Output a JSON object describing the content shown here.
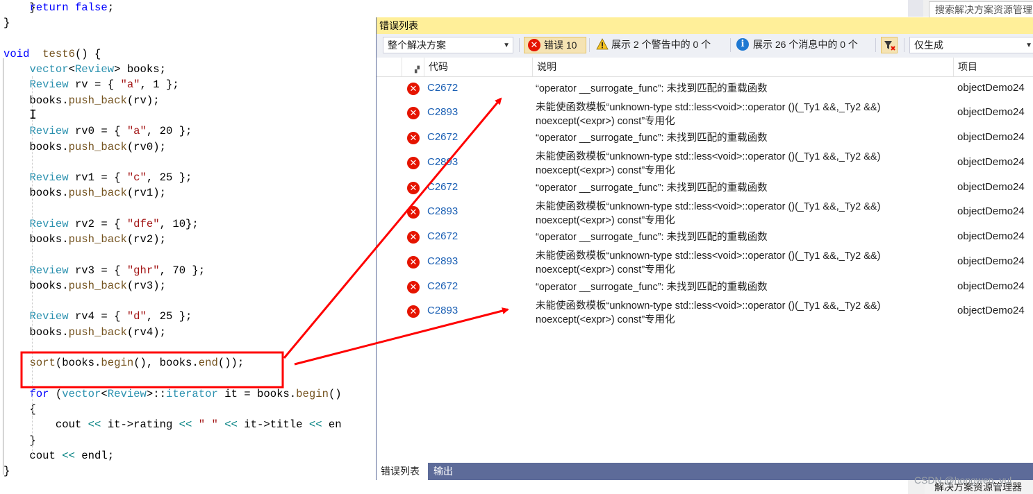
{
  "editor": {
    "lines": [
      [
        {
          "t": "    }",
          "c": ""
        }
      ],
      [
        {
          "t": "    ",
          "c": ""
        },
        {
          "t": "return",
          "c": "kw"
        },
        {
          "t": " ",
          "c": ""
        },
        {
          "t": "false",
          "c": "kw"
        },
        {
          "t": ";",
          "c": ""
        }
      ],
      [
        {
          "t": "}",
          "c": ""
        }
      ],
      [
        {
          "t": "",
          "c": ""
        }
      ],
      [
        {
          "t": "void",
          "c": "kw"
        },
        {
          "t": "  ",
          "c": ""
        },
        {
          "t": "test6",
          "c": "fn"
        },
        {
          "t": "() {",
          "c": ""
        }
      ],
      [
        {
          "t": "    ",
          "c": ""
        },
        {
          "t": "vector",
          "c": "ty"
        },
        {
          "t": "<",
          "c": ""
        },
        {
          "t": "Review",
          "c": "ty"
        },
        {
          "t": "> books;",
          "c": ""
        }
      ],
      [
        {
          "t": "    ",
          "c": ""
        },
        {
          "t": "Review",
          "c": "ty"
        },
        {
          "t": " rv = { ",
          "c": ""
        },
        {
          "t": "\"a\"",
          "c": "str"
        },
        {
          "t": ", 1 };",
          "c": ""
        }
      ],
      [
        {
          "t": "    books.",
          "c": ""
        },
        {
          "t": "push_back",
          "c": "fn"
        },
        {
          "t": "(rv);",
          "c": ""
        }
      ],
      [
        {
          "t": "",
          "c": ""
        }
      ],
      [
        {
          "t": "    ",
          "c": ""
        },
        {
          "t": "Review",
          "c": "ty"
        },
        {
          "t": " rv0 = { ",
          "c": ""
        },
        {
          "t": "\"a\"",
          "c": "str"
        },
        {
          "t": ", 20 };",
          "c": ""
        }
      ],
      [
        {
          "t": "    books.",
          "c": ""
        },
        {
          "t": "push_back",
          "c": "fn"
        },
        {
          "t": "(rv0);",
          "c": ""
        }
      ],
      [
        {
          "t": "",
          "c": ""
        }
      ],
      [
        {
          "t": "    ",
          "c": ""
        },
        {
          "t": "Review",
          "c": "ty"
        },
        {
          "t": " rv1 = { ",
          "c": ""
        },
        {
          "t": "\"c\"",
          "c": "str"
        },
        {
          "t": ", 25 };",
          "c": ""
        }
      ],
      [
        {
          "t": "    books.",
          "c": ""
        },
        {
          "t": "push_back",
          "c": "fn"
        },
        {
          "t": "(rv1);",
          "c": ""
        }
      ],
      [
        {
          "t": "",
          "c": ""
        }
      ],
      [
        {
          "t": "    ",
          "c": ""
        },
        {
          "t": "Review",
          "c": "ty"
        },
        {
          "t": " rv2 = { ",
          "c": ""
        },
        {
          "t": "\"dfe\"",
          "c": "str"
        },
        {
          "t": ", 10};",
          "c": ""
        }
      ],
      [
        {
          "t": "    books.",
          "c": ""
        },
        {
          "t": "push_back",
          "c": "fn"
        },
        {
          "t": "(rv2);",
          "c": ""
        }
      ],
      [
        {
          "t": "",
          "c": ""
        }
      ],
      [
        {
          "t": "    ",
          "c": ""
        },
        {
          "t": "Review",
          "c": "ty"
        },
        {
          "t": " rv3 = { ",
          "c": ""
        },
        {
          "t": "\"ghr\"",
          "c": "str"
        },
        {
          "t": ", 70 };",
          "c": ""
        }
      ],
      [
        {
          "t": "    books.",
          "c": ""
        },
        {
          "t": "push_back",
          "c": "fn"
        },
        {
          "t": "(rv3);",
          "c": ""
        }
      ],
      [
        {
          "t": "",
          "c": ""
        }
      ],
      [
        {
          "t": "    ",
          "c": ""
        },
        {
          "t": "Review",
          "c": "ty"
        },
        {
          "t": " rv4 = { ",
          "c": ""
        },
        {
          "t": "\"d\"",
          "c": "str"
        },
        {
          "t": ", 25 };",
          "c": ""
        }
      ],
      [
        {
          "t": "    books.",
          "c": ""
        },
        {
          "t": "push_back",
          "c": "fn"
        },
        {
          "t": "(rv4);",
          "c": ""
        }
      ],
      [
        {
          "t": "",
          "c": ""
        }
      ],
      [
        {
          "t": "    ",
          "c": ""
        },
        {
          "t": "sort",
          "c": "fn"
        },
        {
          "t": "(books.",
          "c": ""
        },
        {
          "t": "begin",
          "c": "fn"
        },
        {
          "t": "(), books.",
          "c": ""
        },
        {
          "t": "end",
          "c": "fn"
        },
        {
          "t": "());",
          "c": ""
        }
      ],
      [
        {
          "t": "",
          "c": ""
        }
      ],
      [
        {
          "t": "    ",
          "c": ""
        },
        {
          "t": "for",
          "c": "kw"
        },
        {
          "t": " (",
          "c": ""
        },
        {
          "t": "vector",
          "c": "ty"
        },
        {
          "t": "<",
          "c": ""
        },
        {
          "t": "Review",
          "c": "ty"
        },
        {
          "t": ">::",
          "c": ""
        },
        {
          "t": "iterator",
          "c": "ty"
        },
        {
          "t": " it = books.",
          "c": ""
        },
        {
          "t": "begin",
          "c": "fn"
        },
        {
          "t": "()",
          "c": ""
        }
      ],
      [
        {
          "t": "    {",
          "c": ""
        }
      ],
      [
        {
          "t": "        cout ",
          "c": ""
        },
        {
          "t": "<<",
          "c": "op"
        },
        {
          "t": " it->rating ",
          "c": ""
        },
        {
          "t": "<<",
          "c": "op"
        },
        {
          "t": " ",
          "c": ""
        },
        {
          "t": "\" \"",
          "c": "str"
        },
        {
          "t": " ",
          "c": ""
        },
        {
          "t": "<<",
          "c": "op"
        },
        {
          "t": " it->title ",
          "c": ""
        },
        {
          "t": "<<",
          "c": "op"
        },
        {
          "t": " en",
          "c": ""
        }
      ],
      [
        {
          "t": "    }",
          "c": ""
        }
      ],
      [
        {
          "t": "    cout ",
          "c": ""
        },
        {
          "t": "<<",
          "c": "op"
        },
        {
          "t": " endl;",
          "c": ""
        }
      ],
      [
        {
          "t": "}",
          "c": ""
        }
      ]
    ]
  },
  "solution_explorer": {
    "search_placeholder": "搜索解决方案资源管理",
    "bottom_tab": "解决方案资源管理器"
  },
  "watermark": "CSDN @hongwen_yul",
  "error_list": {
    "title": "错误列表",
    "scope": "整个解决方案",
    "errors_btn": "错误 10",
    "warnings_btn": "展示 2 个警告中的 0 个",
    "messages_btn": "展示 26 个消息中的 0 个",
    "build_filter": "仅生成",
    "columns": {
      "code": "代码",
      "description": "说明",
      "project": "项目"
    },
    "rows": [
      {
        "code": "C2672",
        "desc1": "“operator __surrogate_func”: 未找到匹配的重载函数",
        "desc2": "",
        "project": "objectDemo24"
      },
      {
        "code": "C2893",
        "desc1": "未能使函数模板“unknown-type std::less<void>::operator ()(_Ty1 &&,_Ty2 &&)",
        "desc2": "noexcept(<expr>) const”专用化",
        "project": "objectDemo24"
      },
      {
        "code": "C2672",
        "desc1": "“operator __surrogate_func”: 未找到匹配的重载函数",
        "desc2": "",
        "project": "objectDemo24"
      },
      {
        "code": "C2893",
        "desc1": "未能使函数模板“unknown-type std::less<void>::operator ()(_Ty1 &&,_Ty2 &&)",
        "desc2": "noexcept(<expr>) const”专用化",
        "project": "objectDemo24"
      },
      {
        "code": "C2672",
        "desc1": "“operator __surrogate_func”: 未找到匹配的重载函数",
        "desc2": "",
        "project": "objectDemo24"
      },
      {
        "code": "C2893",
        "desc1": "未能使函数模板“unknown-type std::less<void>::operator ()(_Ty1 &&,_Ty2 &&)",
        "desc2": "noexcept(<expr>) const”专用化",
        "project": "objectDemo24"
      },
      {
        "code": "C2672",
        "desc1": "“operator __surrogate_func”: 未找到匹配的重载函数",
        "desc2": "",
        "project": "objectDemo24"
      },
      {
        "code": "C2893",
        "desc1": "未能使函数模板“unknown-type std::less<void>::operator ()(_Ty1 &&,_Ty2 &&)",
        "desc2": "noexcept(<expr>) const”专用化",
        "project": "objectDemo24"
      },
      {
        "code": "C2672",
        "desc1": "“operator __surrogate_func”: 未找到匹配的重载函数",
        "desc2": "",
        "project": "objectDemo24"
      },
      {
        "code": "C2893",
        "desc1": "未能使函数模板“unknown-type std::less<void>::operator ()(_Ty1 &&,_Ty2 &&)",
        "desc2": "noexcept(<expr>) const”专用化",
        "project": "objectDemo24"
      }
    ],
    "tabs": [
      "错误列表",
      "输出"
    ]
  },
  "colors": {
    "annotation_red": "#ff0000",
    "panel_title_bg": "#ffef99",
    "panel_frame": "#5d6b99",
    "error_red": "#e51400",
    "link_blue": "#1a5fb4"
  }
}
